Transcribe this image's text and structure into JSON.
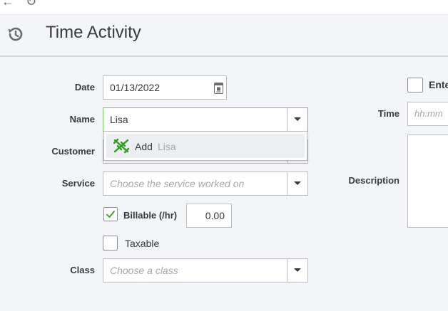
{
  "topbar": {
    "back_glyph": "←",
    "refresh_glyph": "↻"
  },
  "header": {
    "title": "Time Activity",
    "icon": "history-icon"
  },
  "form": {
    "date": {
      "label": "Date",
      "value": "01/13/2022",
      "icon": "calendar-icon"
    },
    "name": {
      "label": "Name",
      "value": "Lisa"
    },
    "customer": {
      "label": "Customer"
    },
    "name_dropdown": {
      "add_prefix": "Add",
      "add_name": "Lisa",
      "icon": "quickbooks-add-icon"
    },
    "service": {
      "label": "Service",
      "placeholder": "Choose the service worked on"
    },
    "billable": {
      "label": "Billable (/hr)",
      "checked": true,
      "rate": "0.00"
    },
    "taxable": {
      "label": "Taxable",
      "checked": false
    },
    "class": {
      "label": "Class",
      "placeholder": "Choose a class"
    },
    "enter_start_end": {
      "label": "Ente",
      "checked": false
    },
    "time": {
      "label": "Time",
      "placeholder": "hh:mm"
    },
    "description": {
      "label": "Description",
      "value": ""
    }
  },
  "colors": {
    "accent_green": "#2ca01c",
    "focus_border": "#7dbc6a"
  }
}
